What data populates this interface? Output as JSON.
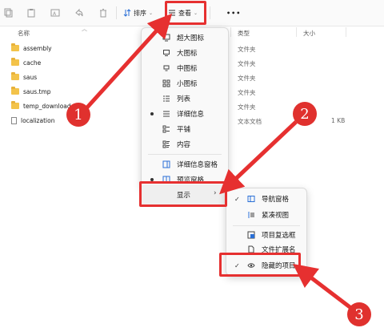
{
  "toolbar": {
    "sort_label": "排序",
    "view_label": "查看",
    "more_label": "•••"
  },
  "columns": {
    "name": "名称",
    "type": "类型",
    "size": "大小"
  },
  "files": [
    {
      "name": "assembly",
      "kind": "folder",
      "type": "文件夹",
      "size": ""
    },
    {
      "name": "cache",
      "kind": "folder",
      "type": "文件夹",
      "size": ""
    },
    {
      "name": "saus",
      "kind": "folder",
      "type": "文件夹",
      "size": ""
    },
    {
      "name": "saus.tmp",
      "kind": "folder",
      "type": "文件夹",
      "size": ""
    },
    {
      "name": "temp_downloads",
      "kind": "folder",
      "type": "文件夹",
      "size": ""
    },
    {
      "name": "localization",
      "kind": "doc",
      "type": "文本文档",
      "size": "1 KB"
    }
  ],
  "view_menu": {
    "items": [
      {
        "label": "超大图标",
        "icon": "monitor-icon",
        "selected": false
      },
      {
        "label": "大图标",
        "icon": "monitor-icon",
        "selected": false
      },
      {
        "label": "中图标",
        "icon": "monitor-small-icon",
        "selected": false
      },
      {
        "label": "小图标",
        "icon": "small-grid-icon",
        "selected": false
      },
      {
        "label": "列表",
        "icon": "list-icon",
        "selected": false
      },
      {
        "label": "详细信息",
        "icon": "details-icon",
        "selected": true
      },
      {
        "label": "平铺",
        "icon": "tiles-icon",
        "selected": false
      },
      {
        "label": "内容",
        "icon": "content-icon",
        "selected": false
      },
      {
        "label": "详细信息窗格",
        "icon": "details-pane-icon",
        "selected": false
      },
      {
        "label": "预览窗格",
        "icon": "preview-pane-icon",
        "selected": true
      }
    ],
    "show_label": "显示"
  },
  "show_menu": {
    "items": [
      {
        "label": "导航窗格",
        "icon": "nav-pane-icon",
        "checked": true
      },
      {
        "label": "紧凑视图",
        "icon": "compact-view-icon",
        "checked": false
      },
      {
        "label": "项目复选框",
        "icon": "checkbox-icon",
        "checked": false
      },
      {
        "label": "文件扩展名",
        "icon": "file-ext-icon",
        "checked": false
      },
      {
        "label": "隐藏的项目",
        "icon": "eye-icon",
        "checked": true
      }
    ]
  },
  "annotations": {
    "step1": "1",
    "step2": "2",
    "step3": "3"
  },
  "colors": {
    "accent_red": "#e63030",
    "folder": "#f3c34a",
    "nav_blue": "#2a6fd6"
  }
}
